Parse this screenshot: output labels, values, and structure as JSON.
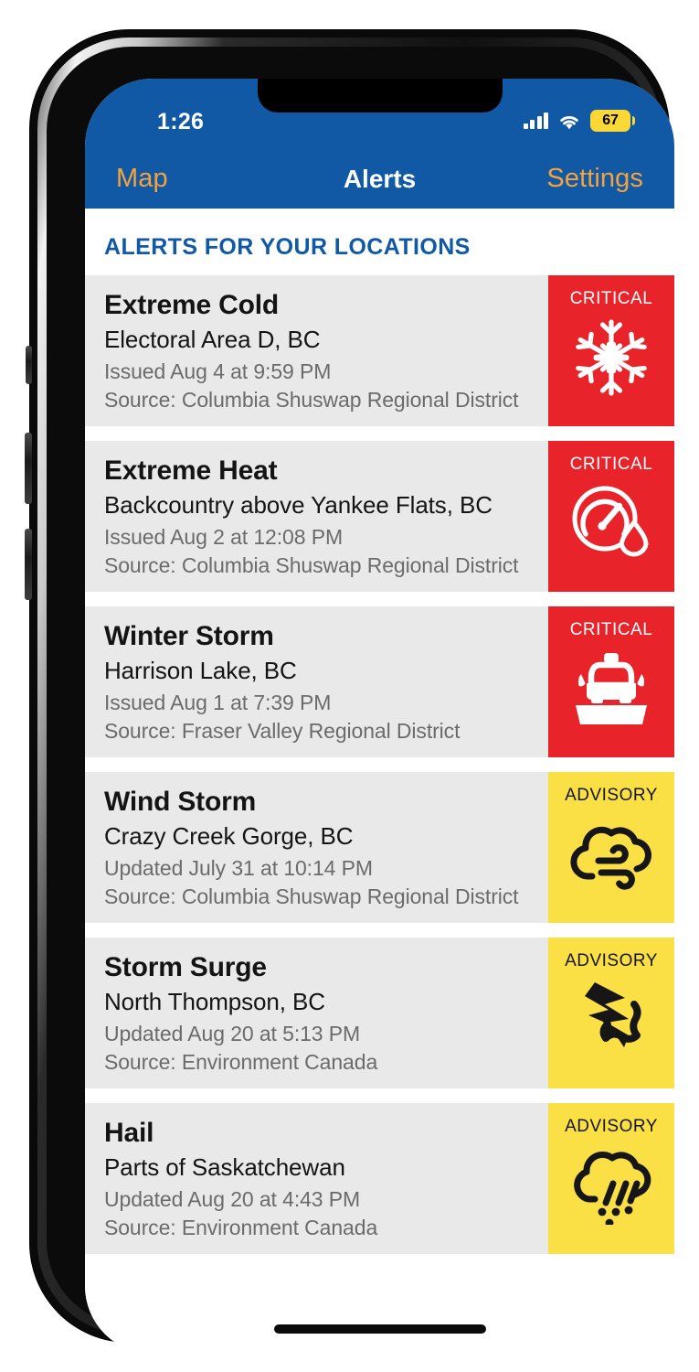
{
  "status_bar": {
    "time": "1:26",
    "signal_icon": "cellular-signal-icon",
    "wifi_icon": "wifi-icon",
    "battery_level": "67",
    "battery_icon": "battery-low-power-icon"
  },
  "nav_bar": {
    "left_label": "Map",
    "title": "Alerts",
    "right_label": "Settings",
    "background_color": "#1159a5",
    "link_color": "#f2a33e"
  },
  "main": {
    "section_header": "ALERTS FOR YOUR LOCATIONS",
    "alerts": [
      {
        "title": "Extreme Cold",
        "location": "Electoral Area D, BC",
        "time": "Issued Aug 4 at 9:59 PM",
        "source": "Source: Columbia Shuswap Regional District",
        "severity": "CRITICAL",
        "severity_class": "badge-critical",
        "severity_color": "#e8232a",
        "icon": "snowflake-icon"
      },
      {
        "title": "Extreme Heat",
        "location": "Backcountry above Yankee Flats, BC",
        "time": "Issued Aug 2 at 12:08 PM",
        "source": "Source: Columbia Shuswap Regional District",
        "severity": "CRITICAL",
        "severity_class": "badge-critical",
        "severity_color": "#e8232a",
        "icon": "humidex-gauge-icon"
      },
      {
        "title": "Winter Storm",
        "location": "Harrison Lake, BC",
        "time": "Issued Aug 1 at 7:39 PM",
        "source": "Source: Fraser Valley Regional District",
        "severity": "CRITICAL",
        "severity_class": "badge-critical",
        "severity_color": "#e8232a",
        "icon": "snowplow-icon"
      },
      {
        "title": "Wind Storm",
        "location": "Crazy Creek Gorge, BC",
        "time": "Updated July 31 at 10:14 PM",
        "source": "Source: Columbia Shuswap Regional District",
        "severity": "ADVISORY",
        "severity_class": "badge-advisory",
        "severity_color": "#fadf45",
        "icon": "wind-cloud-icon"
      },
      {
        "title": "Storm Surge",
        "location": "North Thompson, BC",
        "time": "Updated Aug 20 at 5:13 PM",
        "source": "Source: Environment Canada",
        "severity": "ADVISORY",
        "severity_class": "badge-advisory",
        "severity_color": "#fadf45",
        "icon": "storm-surge-arrow-icon"
      },
      {
        "title": "Hail",
        "location": "Parts of Saskatchewan",
        "time": "Updated Aug 20 at 4:43 PM",
        "source": "Source: Environment Canada",
        "severity": "ADVISORY",
        "severity_class": "badge-advisory",
        "severity_color": "#fadf45",
        "icon": "hail-cloud-icon"
      }
    ]
  },
  "home_indicator": "home-indicator-bar"
}
